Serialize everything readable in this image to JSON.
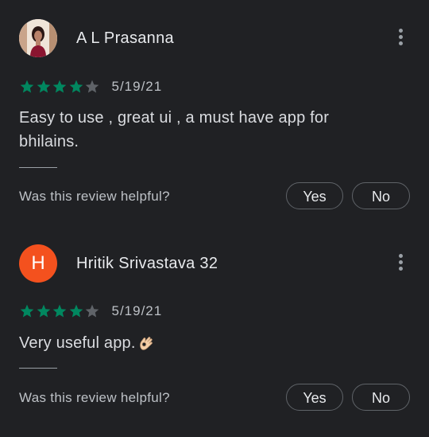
{
  "reviews": [
    {
      "reviewer_name": "A L Prasanna",
      "avatar_type": "photo",
      "rating": 4,
      "rating_max": 5,
      "date": "5/19/21",
      "text": "Easy to use , great ui , a must have app for bhilains.",
      "helpful_prompt": "Was this review helpful?",
      "yes_label": "Yes",
      "no_label": "No"
    },
    {
      "reviewer_name": "Hritik Srivastava 32",
      "avatar_type": "letter",
      "avatar_letter": "H",
      "avatar_color": "#f4511e",
      "rating": 4,
      "rating_max": 5,
      "date": "5/19/21",
      "text": "Very useful app.",
      "text_emoji": "ok-hand-emoji",
      "helpful_prompt": "Was this review helpful?",
      "yes_label": "Yes",
      "no_label": "No"
    }
  ],
  "colors": {
    "background": "#202124",
    "star_filled": "#01875f",
    "star_empty": "#5f6368",
    "text_primary": "#e8eaed",
    "text_secondary": "#bdc1c6"
  },
  "icons": {
    "menu": "more-vert-icon",
    "star": "star-icon"
  }
}
